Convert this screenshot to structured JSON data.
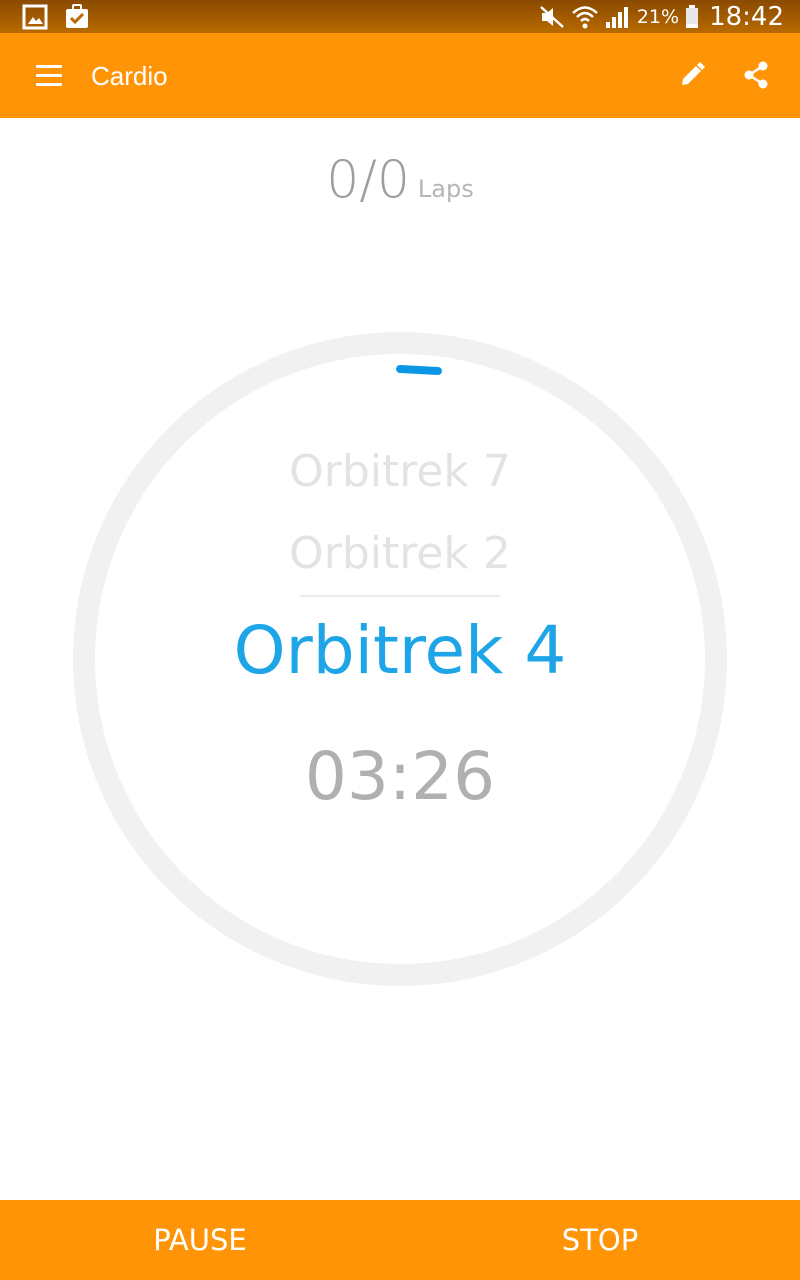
{
  "status_bar": {
    "battery_text": "21%",
    "time": "18:42",
    "icons": [
      "gallery-icon",
      "clipboard-check-icon",
      "mute-icon",
      "wifi-icon",
      "signal-icon",
      "battery-icon"
    ]
  },
  "app_bar": {
    "title": "Cardio",
    "icons": [
      "menu-icon",
      "edit-icon",
      "share-icon"
    ],
    "color": "#ff9506"
  },
  "laps": {
    "count": "0/0",
    "label": "Laps"
  },
  "exercises": {
    "previous": [
      "Orbitrek 7",
      "Orbitrek 2"
    ],
    "current": "Orbitrek 4"
  },
  "timer": "03:26",
  "bottom_bar": {
    "pause_label": "PAUSE",
    "stop_label": "STOP"
  },
  "colors": {
    "accent": "#ff9506",
    "current_exercise": "#1ea5e8",
    "ring": "#f1f1f1",
    "progress_marker": "#0b96e6"
  }
}
